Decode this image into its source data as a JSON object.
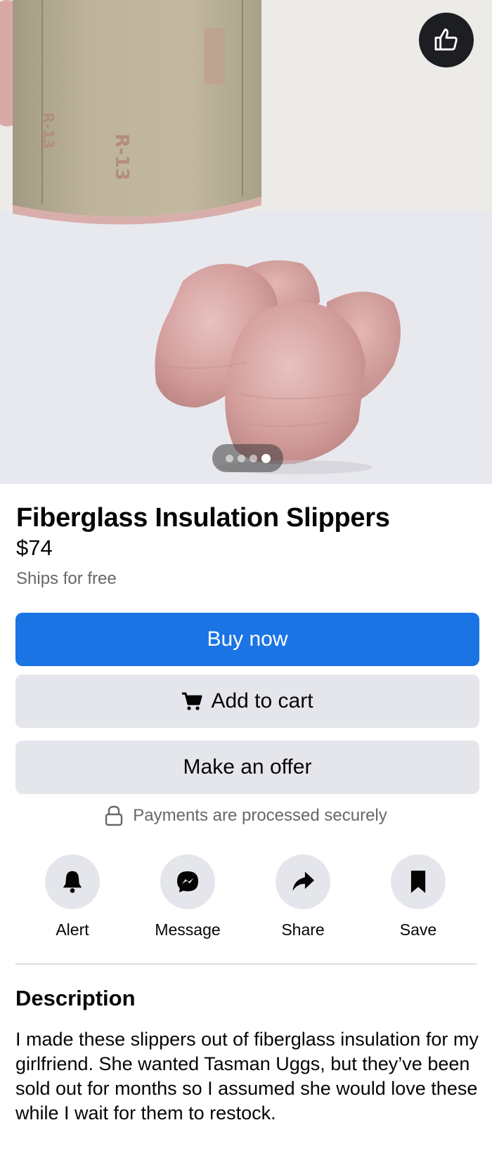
{
  "listing": {
    "title": "Fiberglass Insulation Slippers",
    "price": "$74",
    "shipping": "Ships for free",
    "image_count": 4,
    "active_image_index": 4
  },
  "buttons": {
    "buy_now": "Buy now",
    "add_to_cart": "Add to cart",
    "make_offer": "Make an offer"
  },
  "payments_note": "Payments are processed securely",
  "actions": [
    {
      "label": "Alert",
      "icon": "bell-icon"
    },
    {
      "label": "Message",
      "icon": "messenger-icon"
    },
    {
      "label": "Share",
      "icon": "share-arrow-icon"
    },
    {
      "label": "Save",
      "icon": "bookmark-icon"
    }
  ],
  "description": {
    "heading": "Description",
    "text": "I made these slippers out of fiberglass insulation for my girlfriend. She wanted Tasman Uggs, but they’ve been sold out for months so I assumed she would love these while I wait for them to restock."
  },
  "colors": {
    "primary": "#1b74e4",
    "secondary_button": "#e4e6eb",
    "muted_text": "#65676b"
  }
}
